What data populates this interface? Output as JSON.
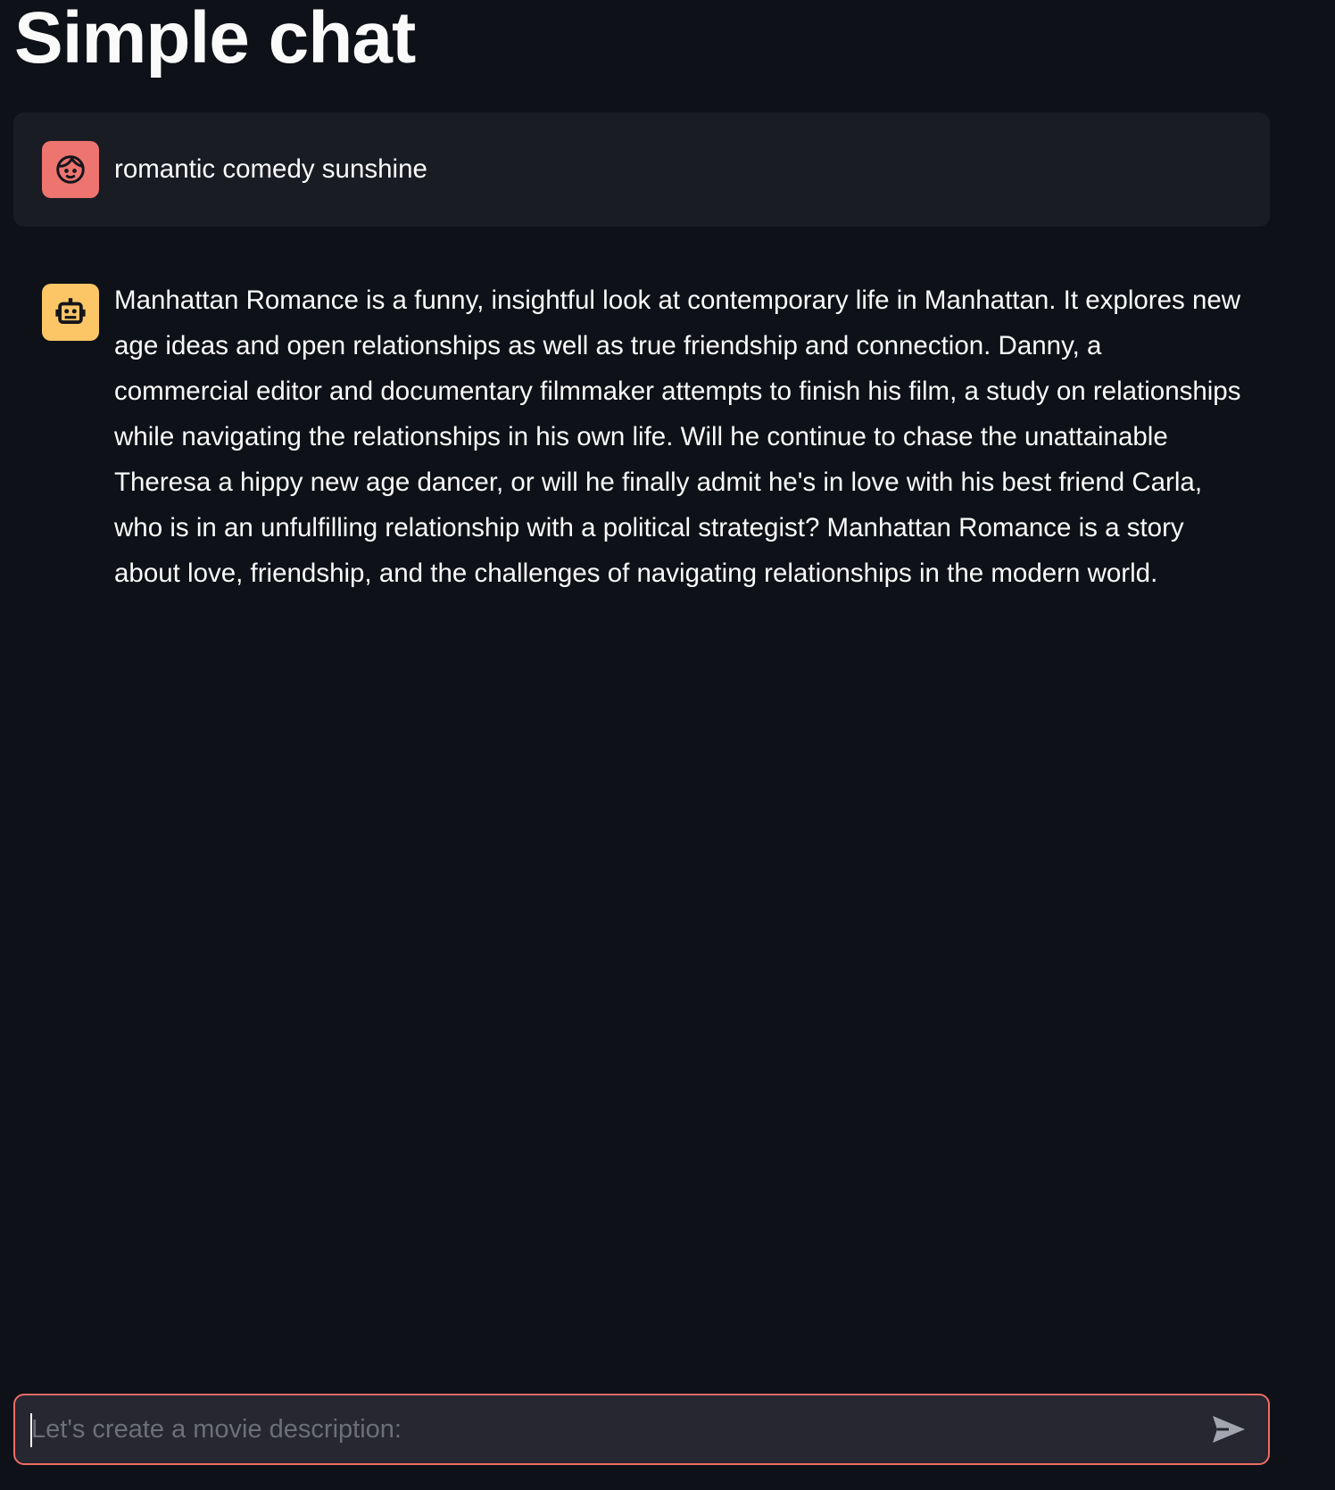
{
  "header": {
    "title": "Simple chat"
  },
  "messages": [
    {
      "role": "user",
      "avatar_icon": "face-icon",
      "text": "romantic comedy sunshine"
    },
    {
      "role": "assistant",
      "avatar_icon": "robot-icon",
      "text": "Manhattan Romance is a funny, insightful look at contemporary life in Manhattan. It explores new age ideas and open relationships as well as true friendship and connection. Danny, a commercial editor and documentary filmmaker attempts to finish his film, a study on relationships while navigating the relationships in his own life. Will he continue to chase the unattainable Theresa a hippy new age dancer, or will he finally admit he's in love with his best friend Carla, who is in an unfulfilling relationship with a political strategist? Manhattan Romance is a story about love, friendship, and the challenges of navigating relationships in the modern world."
    }
  ],
  "chat_input": {
    "placeholder": "Let's create a movie description:",
    "value": "",
    "send_icon": "send-icon"
  },
  "colors": {
    "background": "#0e1117",
    "user_message_bg": "#1a1c24",
    "user_avatar": "#ee7470",
    "assistant_avatar": "#fcc667",
    "input_border": "#ee6c66",
    "input_bg": "#262730"
  }
}
